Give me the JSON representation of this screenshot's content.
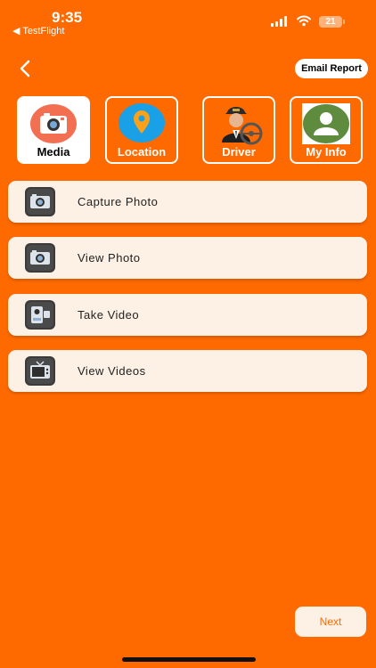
{
  "status": {
    "time": "9:35",
    "back_app": "◀ TestFlight",
    "battery": "21"
  },
  "header": {
    "back_icon": "chevron-left-icon",
    "email_report_label": "Email Report"
  },
  "tabs": [
    {
      "label": "Media",
      "icon": "camera-icon",
      "active": true
    },
    {
      "label": "Location",
      "icon": "map-pin-icon",
      "active": false
    },
    {
      "label": "Driver",
      "icon": "driver-icon",
      "active": false
    },
    {
      "label": "My Info",
      "icon": "person-icon",
      "active": false
    }
  ],
  "menu": [
    {
      "label": "Capture Photo",
      "icon": "camera-icon"
    },
    {
      "label": "View Photo",
      "icon": "camera-icon"
    },
    {
      "label": "Take Video",
      "icon": "video-camera-icon"
    },
    {
      "label": "View Videos",
      "icon": "tv-icon"
    }
  ],
  "footer": {
    "next_label": "Next"
  },
  "colors": {
    "accent": "#FF6A00",
    "card": "#FDF0E4"
  }
}
